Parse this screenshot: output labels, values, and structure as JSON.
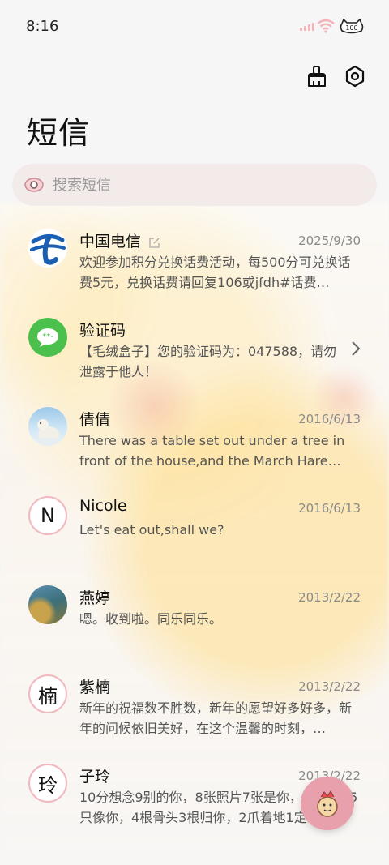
{
  "status_bar": {
    "time": "8:16",
    "battery": "100"
  },
  "page": {
    "title": "短信"
  },
  "search": {
    "placeholder": "搜索短信"
  },
  "conversations": [
    {
      "name": "中国电信",
      "date": "2025/9/30",
      "preview": "欢迎参加积分兑换话费活动，每500分可兑换话费5元，兑换话费请回复106或jfdh#话费…",
      "avatar": "china-telecom-logo"
    },
    {
      "name": "验证码",
      "date": "",
      "preview": "【毛绒盒子】您的验证码为：047588，请勿泄露于他人！",
      "avatar": "message-bubble-icon"
    },
    {
      "name": "倩倩",
      "date": "2016/6/13",
      "preview": "There was a table set out under a tree in front of the house,and the March Hare an…",
      "avatar": "polar-bear-photo"
    },
    {
      "name": "Nicole",
      "date": "2016/6/13",
      "preview": "Let's eat out,shall we?",
      "avatar_letter": "N"
    },
    {
      "name": "燕婷",
      "date": "2013/2/22",
      "preview": "嗯。收到啦。同乐同乐。",
      "avatar": "landscape-photo"
    },
    {
      "name": "紫楠",
      "date": "2013/2/22",
      "preview": "新年的祝福数不胜数，新年的愿望好多好多，新年的问候依旧美好，在这个温馨的时刻，…",
      "avatar_letter": "楠"
    },
    {
      "name": "子玲",
      "date": "2013/2/22",
      "preview": "10分想念9别的你，8张照片7张是你，6只小狗5只像你，4根骨头3根归你，2爪着地1定…",
      "avatar_letter": "玲"
    }
  ],
  "colors": {
    "accent_pink": "#e8a0ad",
    "search_bg": "#f3ebea",
    "avatar_ring": "#f2b8c0",
    "telecom_blue": "#1a5fb4",
    "message_green": "#4cc04c"
  }
}
